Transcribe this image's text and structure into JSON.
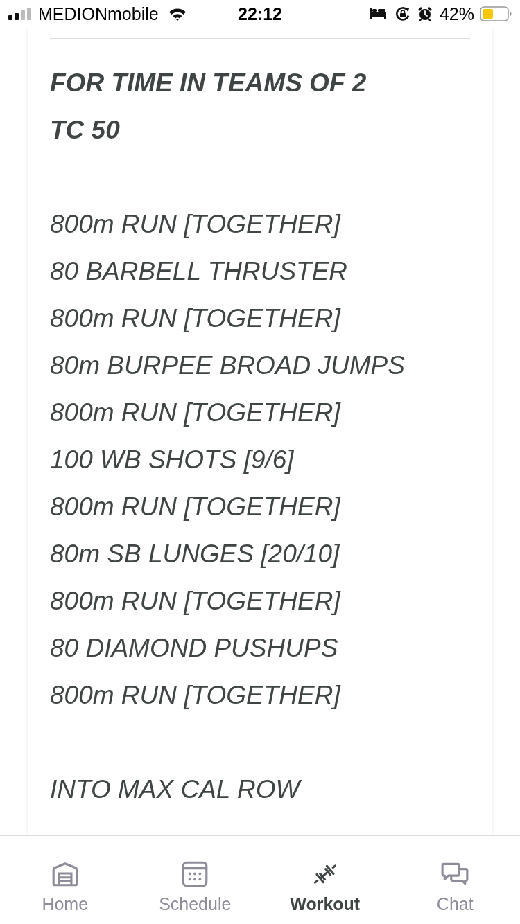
{
  "status_bar": {
    "carrier": "MEDIONmobile",
    "time": "22:12",
    "battery": "42%"
  },
  "workout": {
    "blocks": [
      {
        "kind": "heading",
        "lines": [
          "FOR TIME IN TEAMS OF 2",
          "TC 50"
        ]
      },
      {
        "kind": "body",
        "lines": [
          "800m RUN [TOGETHER]",
          "80 BARBELL THRUSTER",
          "800m RUN [TOGETHER]",
          "80m BURPEE BROAD JUMPS",
          "800m RUN [TOGETHER]",
          "100 WB SHOTS [9/6]",
          "800m RUN [TOGETHER]",
          "80m SB LUNGES [20/10]",
          "800m RUN [TOGETHER]",
          "80 DIAMOND PUSHUPS",
          "800m RUN [TOGETHER]"
        ]
      },
      {
        "kind": "body",
        "lines": [
          "INTO MAX CAL ROW"
        ]
      }
    ]
  },
  "tab_bar": {
    "items": [
      {
        "label": "Home",
        "selected": false
      },
      {
        "label": "Schedule",
        "selected": false
      },
      {
        "label": "Workout",
        "selected": true
      },
      {
        "label": "Chat",
        "selected": false
      }
    ]
  }
}
